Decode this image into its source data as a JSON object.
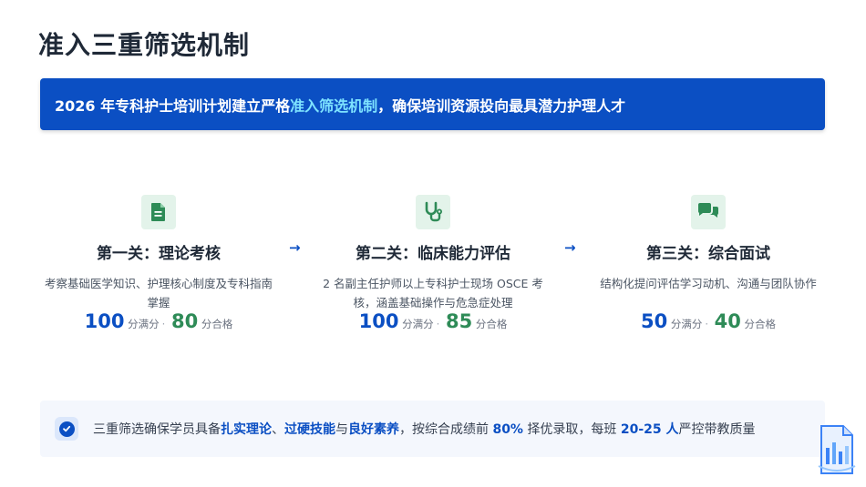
{
  "page": {
    "title": "准入三重筛选机制"
  },
  "banner": {
    "text_before": "2026 年专科护士培训计划建立严格",
    "highlight": "准入筛选机制",
    "text_after": "，确保培训资源投向最具潜力护理人才"
  },
  "stages": [
    {
      "icon": "document-icon",
      "title": "第一关：理论考核",
      "description": "考察基础医学知识、护理核心制度及专科指南掌握",
      "full_score": "100",
      "full_label": "分满分",
      "pass_score": "80",
      "pass_label": "分合格"
    },
    {
      "icon": "stethoscope-icon",
      "title": "第二关：临床能力评估",
      "description": "2 名副主任护师以上专科护士现场 OSCE 考核，涵盖基础操作与危急症处理",
      "full_score": "100",
      "full_label": "分满分",
      "pass_score": "85",
      "pass_label": "分合格"
    },
    {
      "icon": "chat-bubbles-icon",
      "title": "第三关：综合面试",
      "description": "结构化提问评估学习动机、沟通与团队协作",
      "full_score": "50",
      "full_label": "分满分",
      "pass_score": "40",
      "pass_label": "分合格"
    }
  ],
  "score_separator": "·",
  "arrow_glyph": "→",
  "summary": {
    "p1": "三重筛选确保学员具备",
    "b1": "扎实理论",
    "p2": "、",
    "b2": "过硬技能",
    "p3": "与",
    "b3": "良好素养",
    "p4": "，按综合成绩前 ",
    "b4": "80%",
    "p5": " 择优录取，每班 ",
    "b5": "20-25 人",
    "p6": "严控带教质量"
  },
  "colors": {
    "primary": "#0b4fc3",
    "highlight": "#7ee3ff",
    "green": "#2e8b57",
    "icon_bg": "#e3f3ea"
  }
}
